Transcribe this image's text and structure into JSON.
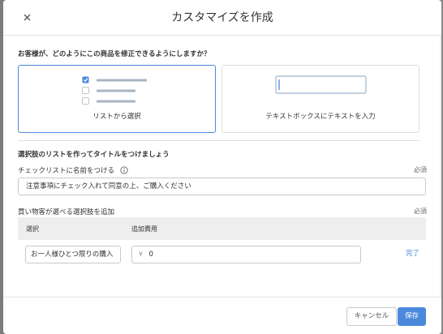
{
  "dialog": {
    "title": "カスタマイズを作成",
    "close_icon": "close-icon"
  },
  "question": "お客様が、どのようにこの商品を修正できるようにしますか？",
  "options": [
    {
      "label": "リストから選択",
      "selected": true,
      "icon": "checklist-icon"
    },
    {
      "label": "テキストボックスにテキストを入力",
      "selected": false,
      "icon": "textbox-icon"
    }
  ],
  "section_title": "選択肢のリストを作ってタイトルをつけましょう",
  "list_name": {
    "label": "チェックリストに名前をつける",
    "info_icon": "info-icon",
    "required": "必須",
    "value": "注意事項にチェック入れて同意の上、ご購入ください"
  },
  "choices": {
    "label": "買い物客が選べる選択肢を追加",
    "required": "必須",
    "columns": [
      "選択",
      "追加費用"
    ],
    "rows": [
      {
        "choice": "お一人様ひとつ限りの購入",
        "currency": "¥",
        "cost": "0"
      }
    ],
    "done_label": "完了"
  },
  "footer": {
    "cancel_label": "キャンセル",
    "save_label": "保存"
  },
  "colors": {
    "accent": "#4a89dc",
    "backdrop": "#8a8a8a"
  }
}
